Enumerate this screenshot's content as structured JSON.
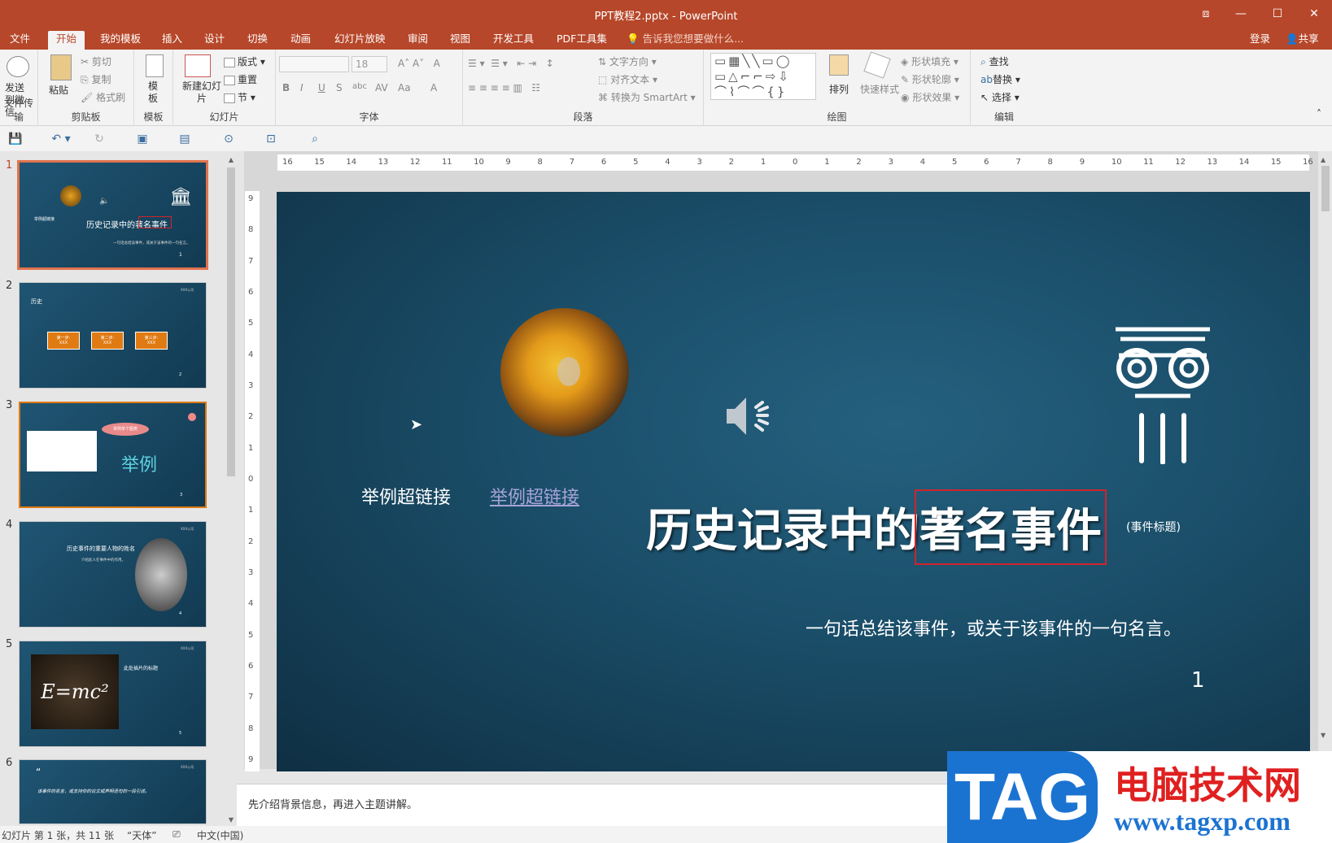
{
  "window": {
    "title": "PPT教程2.pptx - PowerPoint",
    "controls": [
      "⧈",
      "—",
      "☐",
      "✕"
    ]
  },
  "tabs": [
    "文件",
    "开始",
    "我的模板",
    "插入",
    "设计",
    "切换",
    "动画",
    "幻灯片放映",
    "审阅",
    "视图",
    "开发工具",
    "PDF工具集"
  ],
  "active_tab": "开始",
  "tell_me": "告诉我您想要做什么...",
  "account": {
    "login": "登录",
    "share": "共享"
  },
  "ribbon": {
    "groups": {
      "wechat": {
        "label": "文件传输",
        "button": "发送到微信"
      },
      "clipboard": {
        "label": "剪贴板",
        "paste": "粘贴",
        "cut": "剪切",
        "copy": "复制",
        "format_painter": "格式刷"
      },
      "template": {
        "label": "模板",
        "button": "模板"
      },
      "slides": {
        "label": "幻灯片",
        "new_slide": "新建幻灯片",
        "layout": "版式",
        "reset": "重置",
        "section": "节"
      },
      "font": {
        "label": "字体",
        "font_size": "18"
      },
      "paragraph": {
        "label": "段落",
        "text_direction": "文字方向",
        "align_text": "对齐文本",
        "smartart": "转换为 SmartArt"
      },
      "drawing": {
        "label": "绘图",
        "arrange": "排列",
        "quick_styles": "快速样式",
        "shape_fill": "形状填充",
        "shape_outline": "形状轮廓",
        "shape_effects": "形状效果"
      },
      "editing": {
        "label": "编辑",
        "find": "查找",
        "replace": "替换",
        "select": "选择"
      }
    }
  },
  "ruler": {
    "h_ticks": [
      "16",
      "15",
      "14",
      "13",
      "12",
      "11",
      "10",
      "9",
      "8",
      "7",
      "6",
      "5",
      "4",
      "3",
      "2",
      "1",
      "0",
      "1",
      "2",
      "3",
      "4",
      "5",
      "6",
      "7",
      "8",
      "9",
      "10",
      "11",
      "12",
      "13",
      "14",
      "15",
      "16"
    ],
    "v_ticks": [
      "9",
      "8",
      "7",
      "6",
      "5",
      "4",
      "3",
      "2",
      "1",
      "0",
      "1",
      "2",
      "3",
      "4",
      "5",
      "6",
      "7",
      "8",
      "9"
    ]
  },
  "thumbnails": [
    {
      "num": "1",
      "title": "历史记录中的著名事件",
      "sub": "一句话总结该事件，或关于该事件的一句名言。",
      "link": "举例超链接",
      "page": "1"
    },
    {
      "num": "2",
      "title": "历史",
      "steps": [
        "第一步:",
        "第二步:",
        "第三步:"
      ],
      "step_sub": "XXX",
      "page": "2",
      "badge": "XXX公司"
    },
    {
      "num": "3",
      "title": "举例",
      "bubble": "举例单个图表",
      "page": "3"
    },
    {
      "num": "4",
      "title": "历史事件的重要人物的姓名",
      "sub": "介绍此人在事件中的作用。",
      "page": "4",
      "badge": "XXX公司"
    },
    {
      "num": "5",
      "title": "此处插片的标题",
      "formula": "E=mc²",
      "page": "5",
      "badge": "XXX公司"
    },
    {
      "num": "6",
      "quote": "该事件的名言，或支持你的论文或声明语句的一段引述。",
      "page": "6",
      "badge": "XXX公司"
    }
  ],
  "slide": {
    "link_plain": "举例超链接",
    "link_styled": "举例超链接",
    "title_part1": "历史记录中的",
    "title_part2": "著名事件",
    "title_note": "(事件标题)",
    "subtitle": "一句话总结该事件，或关于该事件的一句名言。",
    "page_number": "1"
  },
  "notes": "先介绍背景信息，再进入主题讲解。",
  "status": {
    "slide_info": "幻灯片 第 1 张，共 11 张",
    "theme": "“天体”",
    "language": "中文(中国)"
  },
  "watermark": {
    "tag": "TAG",
    "name": "电脑技术网",
    "url": "www.tagxp.com"
  },
  "colors": {
    "accent": "#b7472a",
    "slide_bg": "#1a4d68",
    "selection": "#d0242c",
    "link": "#a7a3d6",
    "orange": "#e07a12"
  }
}
